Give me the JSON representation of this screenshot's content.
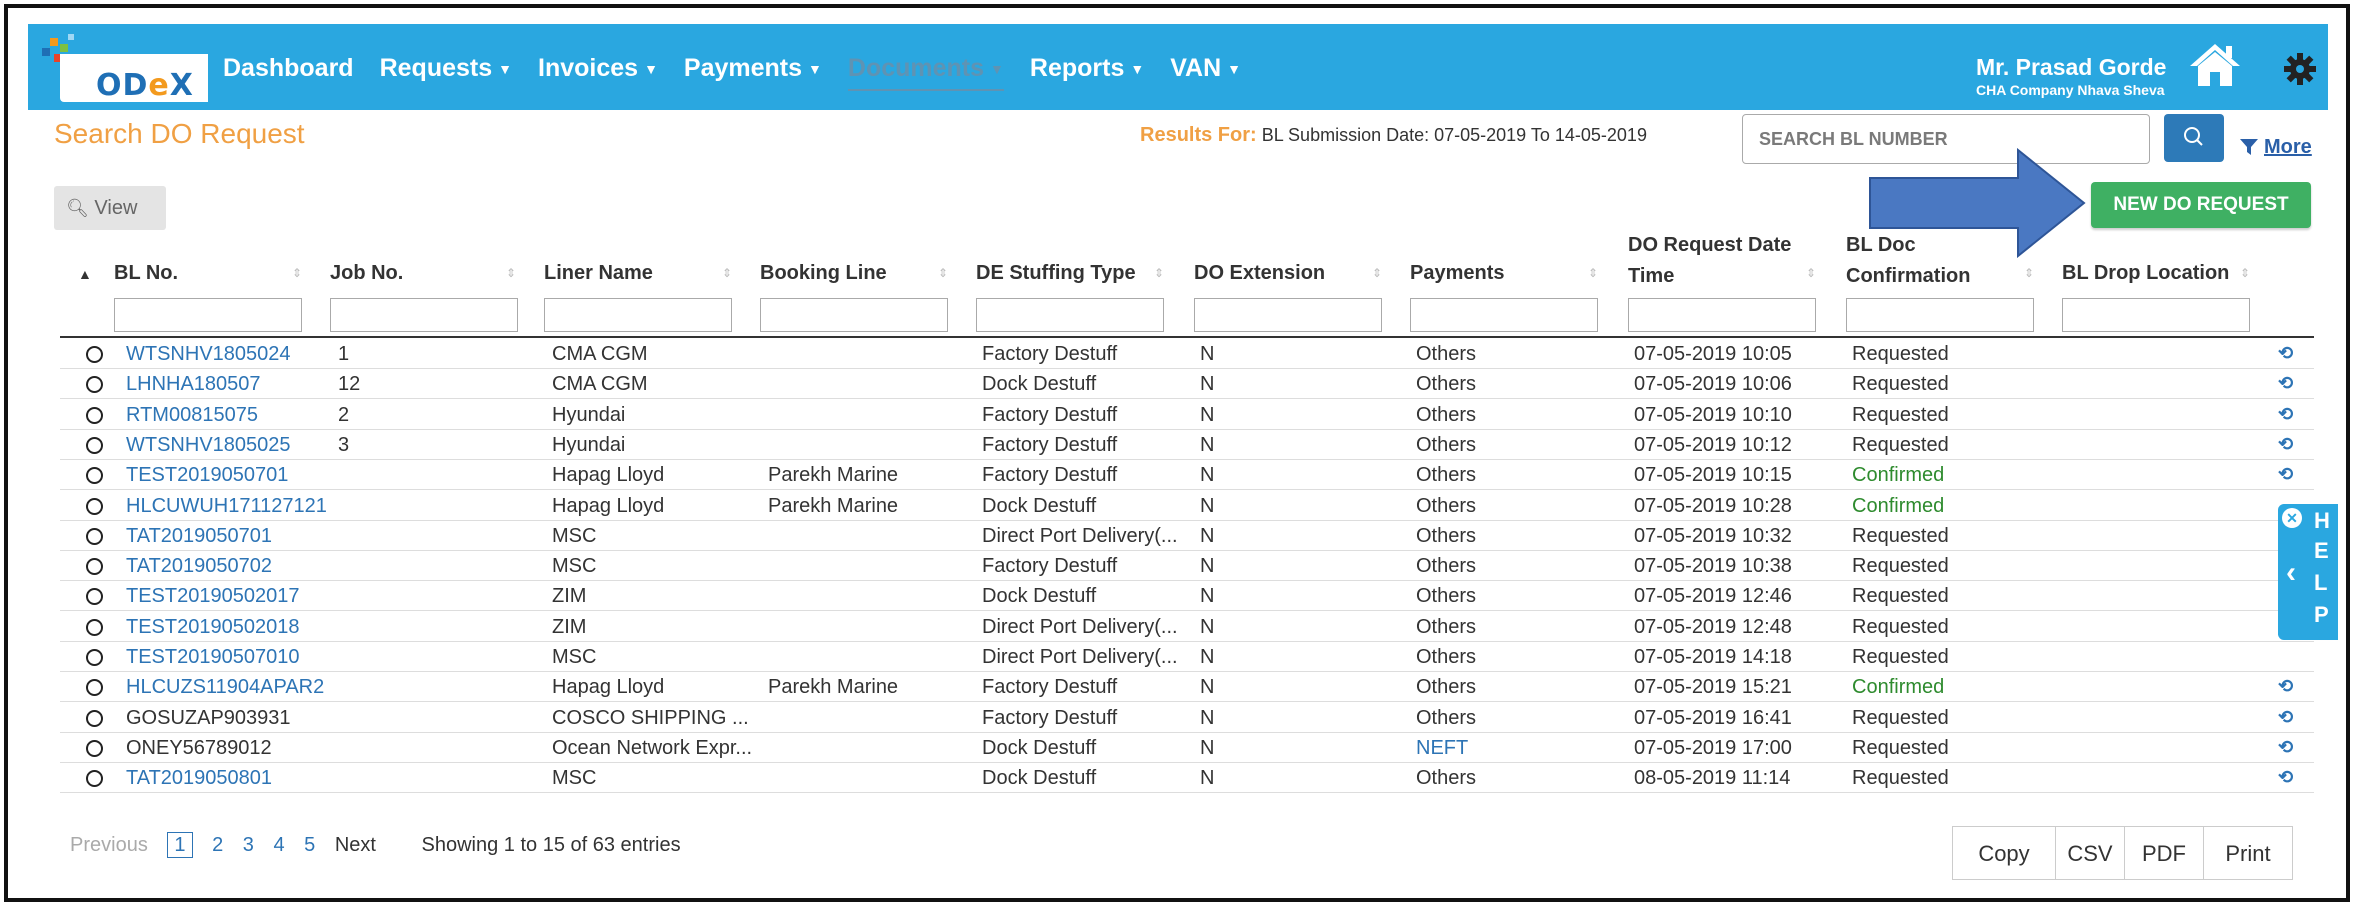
{
  "nav": {
    "logo_text_o": "OD",
    "logo_text_e": "e",
    "logo_text_x": "X",
    "items": [
      {
        "label": "Dashboard",
        "caret": false
      },
      {
        "label": "Requests",
        "caret": true
      },
      {
        "label": "Invoices",
        "caret": true
      },
      {
        "label": "Payments",
        "caret": true
      },
      {
        "label": "Documents",
        "caret": true,
        "disabled": true
      },
      {
        "label": "Reports",
        "caret": true
      },
      {
        "label": "VAN",
        "caret": true
      }
    ],
    "user_name": "Mr. Prasad Gorde",
    "user_sub": "CHA Company Nhava Sheva"
  },
  "page": {
    "title": "Search DO Request",
    "results_label": "Results For:",
    "results_text": "BL Submission Date: 07-05-2019  To  14-05-2019",
    "search_placeholder": "SEARCH BL NUMBER",
    "more": "More",
    "view": "View",
    "new_do": "NEW DO REQUEST"
  },
  "table": {
    "headers": {
      "bl_no": "BL No.",
      "job_no": "Job No.",
      "liner": "Liner Name",
      "booking": "Booking Line",
      "stuffing": "DE Stuffing Type",
      "extension": "DO Extension",
      "payments": "Payments",
      "req_date_1": "DO Request Date",
      "req_date_2": "Time",
      "bl_doc_1": "BL Doc",
      "bl_doc_2": "Confirmation",
      "drop": "BL Drop Location"
    },
    "rows": [
      {
        "bl": "WTSNHV1805024",
        "bl_link": true,
        "job": "1",
        "liner": "CMA CGM",
        "booking": "",
        "stuffing": "Factory Destuff",
        "ext": "N",
        "pay": "Others",
        "pay_link": false,
        "date": "07-05-2019 10:05",
        "conf": "Requested"
      },
      {
        "bl": "LHNHA180507",
        "bl_link": true,
        "job": "12",
        "liner": "CMA CGM",
        "booking": "",
        "stuffing": "Dock Destuff",
        "ext": "N",
        "pay": "Others",
        "pay_link": false,
        "date": "07-05-2019 10:06",
        "conf": "Requested"
      },
      {
        "bl": "RTM00815075",
        "bl_link": true,
        "job": "2",
        "liner": "Hyundai",
        "booking": "",
        "stuffing": "Factory Destuff",
        "ext": "N",
        "pay": "Others",
        "pay_link": false,
        "date": "07-05-2019 10:10",
        "conf": "Requested"
      },
      {
        "bl": "WTSNHV1805025",
        "bl_link": true,
        "job": "3",
        "liner": "Hyundai",
        "booking": "",
        "stuffing": "Factory Destuff",
        "ext": "N",
        "pay": "Others",
        "pay_link": false,
        "date": "07-05-2019 10:12",
        "conf": "Requested"
      },
      {
        "bl": "TEST2019050701",
        "bl_link": true,
        "job": "",
        "liner": "Hapag Lloyd",
        "booking": "Parekh Marine",
        "stuffing": "Factory Destuff",
        "ext": "N",
        "pay": "Others",
        "pay_link": false,
        "date": "07-05-2019 10:15",
        "conf": "Confirmed"
      },
      {
        "bl": "HLCUWUH171127121",
        "bl_link": true,
        "job": "",
        "liner": "Hapag Lloyd",
        "booking": "Parekh Marine",
        "stuffing": "Dock Destuff",
        "ext": "N",
        "pay": "Others",
        "pay_link": false,
        "date": "07-05-2019 10:28",
        "conf": "Confirmed"
      },
      {
        "bl": "TAT2019050701",
        "bl_link": true,
        "job": "",
        "liner": "MSC",
        "booking": "",
        "stuffing": "Direct Port Delivery(...",
        "ext": "N",
        "pay": "Others",
        "pay_link": false,
        "date": "07-05-2019 10:32",
        "conf": "Requested"
      },
      {
        "bl": "TAT2019050702",
        "bl_link": true,
        "job": "",
        "liner": "MSC",
        "booking": "",
        "stuffing": "Factory Destuff",
        "ext": "N",
        "pay": "Others",
        "pay_link": false,
        "date": "07-05-2019 10:38",
        "conf": "Requested"
      },
      {
        "bl": "TEST20190502017",
        "bl_link": true,
        "job": "",
        "liner": "ZIM",
        "booking": "",
        "stuffing": "Dock Destuff",
        "ext": "N",
        "pay": "Others",
        "pay_link": false,
        "date": "07-05-2019 12:46",
        "conf": "Requested"
      },
      {
        "bl": "TEST20190502018",
        "bl_link": true,
        "job": "",
        "liner": "ZIM",
        "booking": "",
        "stuffing": "Direct Port Delivery(...",
        "ext": "N",
        "pay": "Others",
        "pay_link": false,
        "date": "07-05-2019 12:48",
        "conf": "Requested"
      },
      {
        "bl": "TEST20190507010",
        "bl_link": true,
        "job": "",
        "liner": "MSC",
        "booking": "",
        "stuffing": "Direct Port Delivery(...",
        "ext": "N",
        "pay": "Others",
        "pay_link": false,
        "date": "07-05-2019 14:18",
        "conf": "Requested"
      },
      {
        "bl": "HLCUZS11904APAR2",
        "bl_link": true,
        "job": "",
        "liner": "Hapag Lloyd",
        "booking": "Parekh Marine",
        "stuffing": "Factory Destuff",
        "ext": "N",
        "pay": "Others",
        "pay_link": false,
        "date": "07-05-2019 15:21",
        "conf": "Confirmed"
      },
      {
        "bl": "GOSUZAP903931",
        "bl_link": false,
        "job": "",
        "liner": "COSCO SHIPPING ...",
        "booking": "",
        "stuffing": "Factory Destuff",
        "ext": "N",
        "pay": "Others",
        "pay_link": false,
        "date": "07-05-2019 16:41",
        "conf": "Requested"
      },
      {
        "bl": "ONEY56789012",
        "bl_link": false,
        "job": "",
        "liner": "Ocean Network Expr...",
        "booking": "",
        "stuffing": "Dock Destuff",
        "ext": "N",
        "pay": "NEFT",
        "pay_link": true,
        "date": "07-05-2019 17:00",
        "conf": "Requested"
      },
      {
        "bl": "TAT2019050801",
        "bl_link": true,
        "job": "",
        "liner": "MSC",
        "booking": "",
        "stuffing": "Dock Destuff",
        "ext": "N",
        "pay": "Others",
        "pay_link": false,
        "date": "08-05-2019 11:14",
        "conf": "Requested"
      }
    ]
  },
  "help": {
    "letters": [
      "H",
      "E",
      "L",
      "P"
    ]
  },
  "pager": {
    "prev": "Previous",
    "pages": [
      "1",
      "2",
      "3",
      "4",
      "5"
    ],
    "next": "Next",
    "info": "Showing 1 to 15 of 63 entries"
  },
  "export": [
    "Copy",
    "CSV",
    "PDF",
    "Print"
  ],
  "colors": {
    "navbar": "#2aa7e0",
    "accent_orange": "#f0a044",
    "link": "#2d74b5",
    "confirm_green": "#2e8b2e",
    "new_button": "#3fb063"
  }
}
